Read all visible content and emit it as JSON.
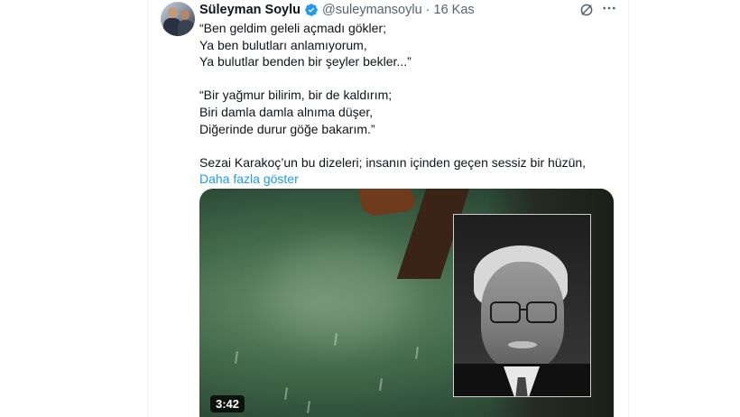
{
  "tweet": {
    "author_name": "Süleyman Soylu",
    "handle": "@suleymansoylu",
    "separator": "·",
    "date": "16 Kas",
    "text_lines": [
      "“Ben geldim geleli açmadı gökler;",
      "Ya ben bulutları anlamıyorum,",
      "Ya bulutlar benden bir şeyler bekler...”",
      "",
      "“Bir yağmur bilirim, bir de kaldırım;",
      "Biri damla damla alnıma düşer,",
      "Diğerinde durur göğe bakarım.”",
      "",
      "Sezai Karakoç’un bu dizeleri; insanın içinden geçen sessiz bir hüzün,"
    ],
    "show_more": "Daha fazla göster",
    "video": {
      "duration": "3:42"
    }
  },
  "icons": {
    "verified": "verified-badge-icon",
    "grok": "grok-icon",
    "more": "more-icon"
  },
  "colors": {
    "link": "#1d9bf0",
    "secondary_text": "#536471",
    "verified": "#1d9bf0"
  }
}
